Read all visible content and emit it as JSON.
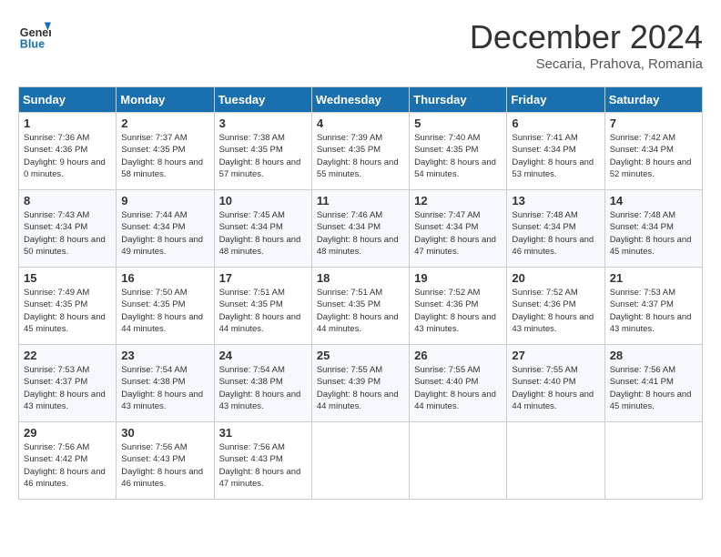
{
  "header": {
    "logo_line1": "General",
    "logo_line2": "Blue",
    "month": "December 2024",
    "location": "Secaria, Prahova, Romania"
  },
  "days_of_week": [
    "Sunday",
    "Monday",
    "Tuesday",
    "Wednesday",
    "Thursday",
    "Friday",
    "Saturday"
  ],
  "weeks": [
    [
      {
        "day": 1,
        "sunrise": "7:36 AM",
        "sunset": "4:36 PM",
        "daylight": "9 hours and 0 minutes."
      },
      {
        "day": 2,
        "sunrise": "7:37 AM",
        "sunset": "4:35 PM",
        "daylight": "8 hours and 58 minutes."
      },
      {
        "day": 3,
        "sunrise": "7:38 AM",
        "sunset": "4:35 PM",
        "daylight": "8 hours and 57 minutes."
      },
      {
        "day": 4,
        "sunrise": "7:39 AM",
        "sunset": "4:35 PM",
        "daylight": "8 hours and 55 minutes."
      },
      {
        "day": 5,
        "sunrise": "7:40 AM",
        "sunset": "4:35 PM",
        "daylight": "8 hours and 54 minutes."
      },
      {
        "day": 6,
        "sunrise": "7:41 AM",
        "sunset": "4:34 PM",
        "daylight": "8 hours and 53 minutes."
      },
      {
        "day": 7,
        "sunrise": "7:42 AM",
        "sunset": "4:34 PM",
        "daylight": "8 hours and 52 minutes."
      }
    ],
    [
      {
        "day": 8,
        "sunrise": "7:43 AM",
        "sunset": "4:34 PM",
        "daylight": "8 hours and 50 minutes."
      },
      {
        "day": 9,
        "sunrise": "7:44 AM",
        "sunset": "4:34 PM",
        "daylight": "8 hours and 49 minutes."
      },
      {
        "day": 10,
        "sunrise": "7:45 AM",
        "sunset": "4:34 PM",
        "daylight": "8 hours and 48 minutes."
      },
      {
        "day": 11,
        "sunrise": "7:46 AM",
        "sunset": "4:34 PM",
        "daylight": "8 hours and 48 minutes."
      },
      {
        "day": 12,
        "sunrise": "7:47 AM",
        "sunset": "4:34 PM",
        "daylight": "8 hours and 47 minutes."
      },
      {
        "day": 13,
        "sunrise": "7:48 AM",
        "sunset": "4:34 PM",
        "daylight": "8 hours and 46 minutes."
      },
      {
        "day": 14,
        "sunrise": "7:48 AM",
        "sunset": "4:34 PM",
        "daylight": "8 hours and 45 minutes."
      }
    ],
    [
      {
        "day": 15,
        "sunrise": "7:49 AM",
        "sunset": "4:35 PM",
        "daylight": "8 hours and 45 minutes."
      },
      {
        "day": 16,
        "sunrise": "7:50 AM",
        "sunset": "4:35 PM",
        "daylight": "8 hours and 44 minutes."
      },
      {
        "day": 17,
        "sunrise": "7:51 AM",
        "sunset": "4:35 PM",
        "daylight": "8 hours and 44 minutes."
      },
      {
        "day": 18,
        "sunrise": "7:51 AM",
        "sunset": "4:35 PM",
        "daylight": "8 hours and 44 minutes."
      },
      {
        "day": 19,
        "sunrise": "7:52 AM",
        "sunset": "4:36 PM",
        "daylight": "8 hours and 43 minutes."
      },
      {
        "day": 20,
        "sunrise": "7:52 AM",
        "sunset": "4:36 PM",
        "daylight": "8 hours and 43 minutes."
      },
      {
        "day": 21,
        "sunrise": "7:53 AM",
        "sunset": "4:37 PM",
        "daylight": "8 hours and 43 minutes."
      }
    ],
    [
      {
        "day": 22,
        "sunrise": "7:53 AM",
        "sunset": "4:37 PM",
        "daylight": "8 hours and 43 minutes."
      },
      {
        "day": 23,
        "sunrise": "7:54 AM",
        "sunset": "4:38 PM",
        "daylight": "8 hours and 43 minutes."
      },
      {
        "day": 24,
        "sunrise": "7:54 AM",
        "sunset": "4:38 PM",
        "daylight": "8 hours and 43 minutes."
      },
      {
        "day": 25,
        "sunrise": "7:55 AM",
        "sunset": "4:39 PM",
        "daylight": "8 hours and 44 minutes."
      },
      {
        "day": 26,
        "sunrise": "7:55 AM",
        "sunset": "4:40 PM",
        "daylight": "8 hours and 44 minutes."
      },
      {
        "day": 27,
        "sunrise": "7:55 AM",
        "sunset": "4:40 PM",
        "daylight": "8 hours and 44 minutes."
      },
      {
        "day": 28,
        "sunrise": "7:56 AM",
        "sunset": "4:41 PM",
        "daylight": "8 hours and 45 minutes."
      }
    ],
    [
      {
        "day": 29,
        "sunrise": "7:56 AM",
        "sunset": "4:42 PM",
        "daylight": "8 hours and 46 minutes."
      },
      {
        "day": 30,
        "sunrise": "7:56 AM",
        "sunset": "4:43 PM",
        "daylight": "8 hours and 46 minutes."
      },
      {
        "day": 31,
        "sunrise": "7:56 AM",
        "sunset": "4:43 PM",
        "daylight": "8 hours and 47 minutes."
      },
      null,
      null,
      null,
      null
    ]
  ]
}
